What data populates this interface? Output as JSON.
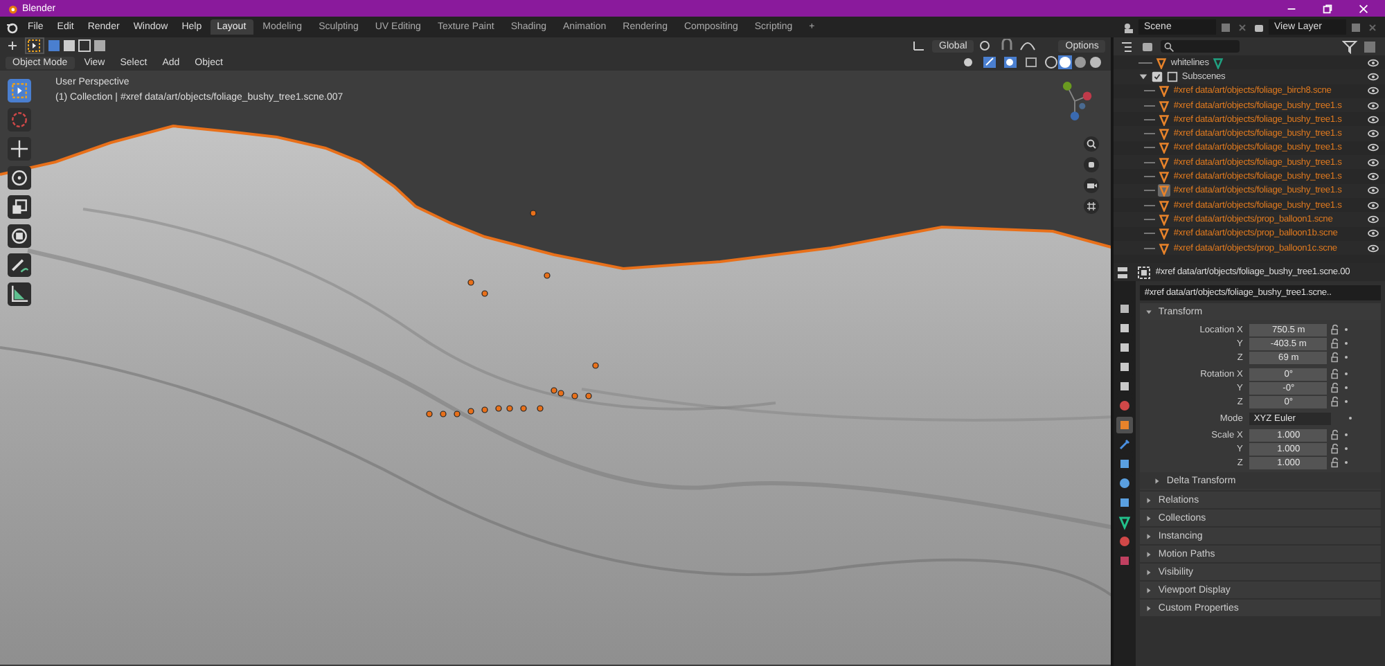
{
  "window": {
    "title": "Blender"
  },
  "menu": [
    "File",
    "Edit",
    "Render",
    "Window",
    "Help"
  ],
  "workspaces": [
    {
      "label": "Layout",
      "selected": true
    },
    {
      "label": "Modeling",
      "selected": false
    },
    {
      "label": "Sculpting",
      "selected": false
    },
    {
      "label": "UV Editing",
      "selected": false
    },
    {
      "label": "Texture Paint",
      "selected": false
    },
    {
      "label": "Shading",
      "selected": false
    },
    {
      "label": "Animation",
      "selected": false
    },
    {
      "label": "Rendering",
      "selected": false
    },
    {
      "label": "Compositing",
      "selected": false
    },
    {
      "label": "Scripting",
      "selected": false
    }
  ],
  "add_workspace": "+",
  "scene": "Scene",
  "view_layer": "View Layer",
  "tool_header": {
    "orientation": "Global",
    "options": "Options"
  },
  "viewport_header": {
    "mode": "Object Mode",
    "menus": [
      "View",
      "Select",
      "Add",
      "Object"
    ]
  },
  "viewport": {
    "view_name": "User Perspective",
    "object_info": "(1) Collection | #xref data/art/objects/foliage_bushy_tree1.scne.007"
  },
  "toolbar": [
    {
      "selected": true
    },
    {
      "selected": false
    },
    {
      "selected": false
    },
    {
      "selected": false
    },
    {
      "selected": false
    },
    {
      "selected": false
    },
    {
      "selected": false
    },
    {
      "selected": false
    }
  ],
  "outliner": {
    "items": [
      {
        "name": "whitelines",
        "kind": "mesh"
      },
      {
        "name": "Subscenes",
        "kind": "collection",
        "expanded": true,
        "children": [
          {
            "name": "#xref data/art/objects/foliage_birch8.scne",
            "kind": "xref",
            "selected": false
          },
          {
            "name": "#xref data/art/objects/foliage_bushy_tree1.s",
            "kind": "xref",
            "selected": false
          },
          {
            "name": "#xref data/art/objects/foliage_bushy_tree1.s",
            "kind": "xref",
            "selected": false
          },
          {
            "name": "#xref data/art/objects/foliage_bushy_tree1.s",
            "kind": "xref",
            "selected": false
          },
          {
            "name": "#xref data/art/objects/foliage_bushy_tree1.s",
            "kind": "xref",
            "selected": false
          },
          {
            "name": "#xref data/art/objects/foliage_bushy_tree1.s",
            "kind": "xref",
            "selected": false
          },
          {
            "name": "#xref data/art/objects/foliage_bushy_tree1.s",
            "kind": "xref",
            "selected": false
          },
          {
            "name": "#xref data/art/objects/foliage_bushy_tree1.s",
            "kind": "xref",
            "selected": true
          },
          {
            "name": "#xref data/art/objects/foliage_bushy_tree1.s",
            "kind": "xref",
            "selected": false
          },
          {
            "name": "#xref data/art/objects/prop_balloon1.scne",
            "kind": "xref",
            "selected": false
          },
          {
            "name": "#xref data/art/objects/prop_balloon1b.scne",
            "kind": "xref",
            "selected": false
          },
          {
            "name": "#xref data/art/objects/prop_balloon1c.scne",
            "kind": "xref",
            "selected": false
          }
        ]
      }
    ]
  },
  "properties": {
    "context": "#xref data/art/objects/foliage_bushy_tree1.scne.00",
    "object_name": "#xref data/art/objects/foliage_bushy_tree1.scne..",
    "tabs": [
      {
        "selected": false
      },
      {
        "selected": false
      },
      {
        "selected": false
      },
      {
        "selected": false
      },
      {
        "selected": false
      },
      {
        "selected": false
      },
      {
        "selected": true
      },
      {
        "selected": false
      },
      {
        "selected": false
      },
      {
        "selected": false
      },
      {
        "selected": false
      },
      {
        "selected": false
      },
      {
        "selected": false
      },
      {
        "selected": false
      }
    ],
    "panels": [
      {
        "title": "Transform",
        "expanded": true,
        "groups": [
          [
            {
              "label": "Location X",
              "value": "750.5 m",
              "kind": "number"
            },
            {
              "label": "Y",
              "value": "-403.5 m",
              "kind": "number"
            },
            {
              "label": "Z",
              "value": "69 m",
              "kind": "number"
            }
          ],
          [
            {
              "label": "Rotation X",
              "value": "0°",
              "kind": "number"
            },
            {
              "label": "Y",
              "value": "-0°",
              "kind": "number"
            },
            {
              "label": "Z",
              "value": "0°",
              "kind": "number"
            }
          ],
          [
            {
              "label": "Mode",
              "value": "XYZ Euler",
              "kind": "dropdown"
            }
          ],
          [
            {
              "label": "Scale X",
              "value": "1.000",
              "kind": "number"
            },
            {
              "label": "Y",
              "value": "1.000",
              "kind": "number"
            },
            {
              "label": "Z",
              "value": "1.000",
              "kind": "number"
            }
          ]
        ],
        "subpanels": [
          {
            "title": "Delta Transform",
            "expanded": false
          }
        ]
      },
      {
        "title": "Relations",
        "expanded": false
      },
      {
        "title": "Collections",
        "expanded": false
      },
      {
        "title": "Instancing",
        "expanded": false
      },
      {
        "title": "Motion Paths",
        "expanded": false
      },
      {
        "title": "Visibility",
        "expanded": false
      },
      {
        "title": "Viewport Display",
        "expanded": false
      },
      {
        "title": "Custom Properties",
        "expanded": false
      }
    ]
  }
}
